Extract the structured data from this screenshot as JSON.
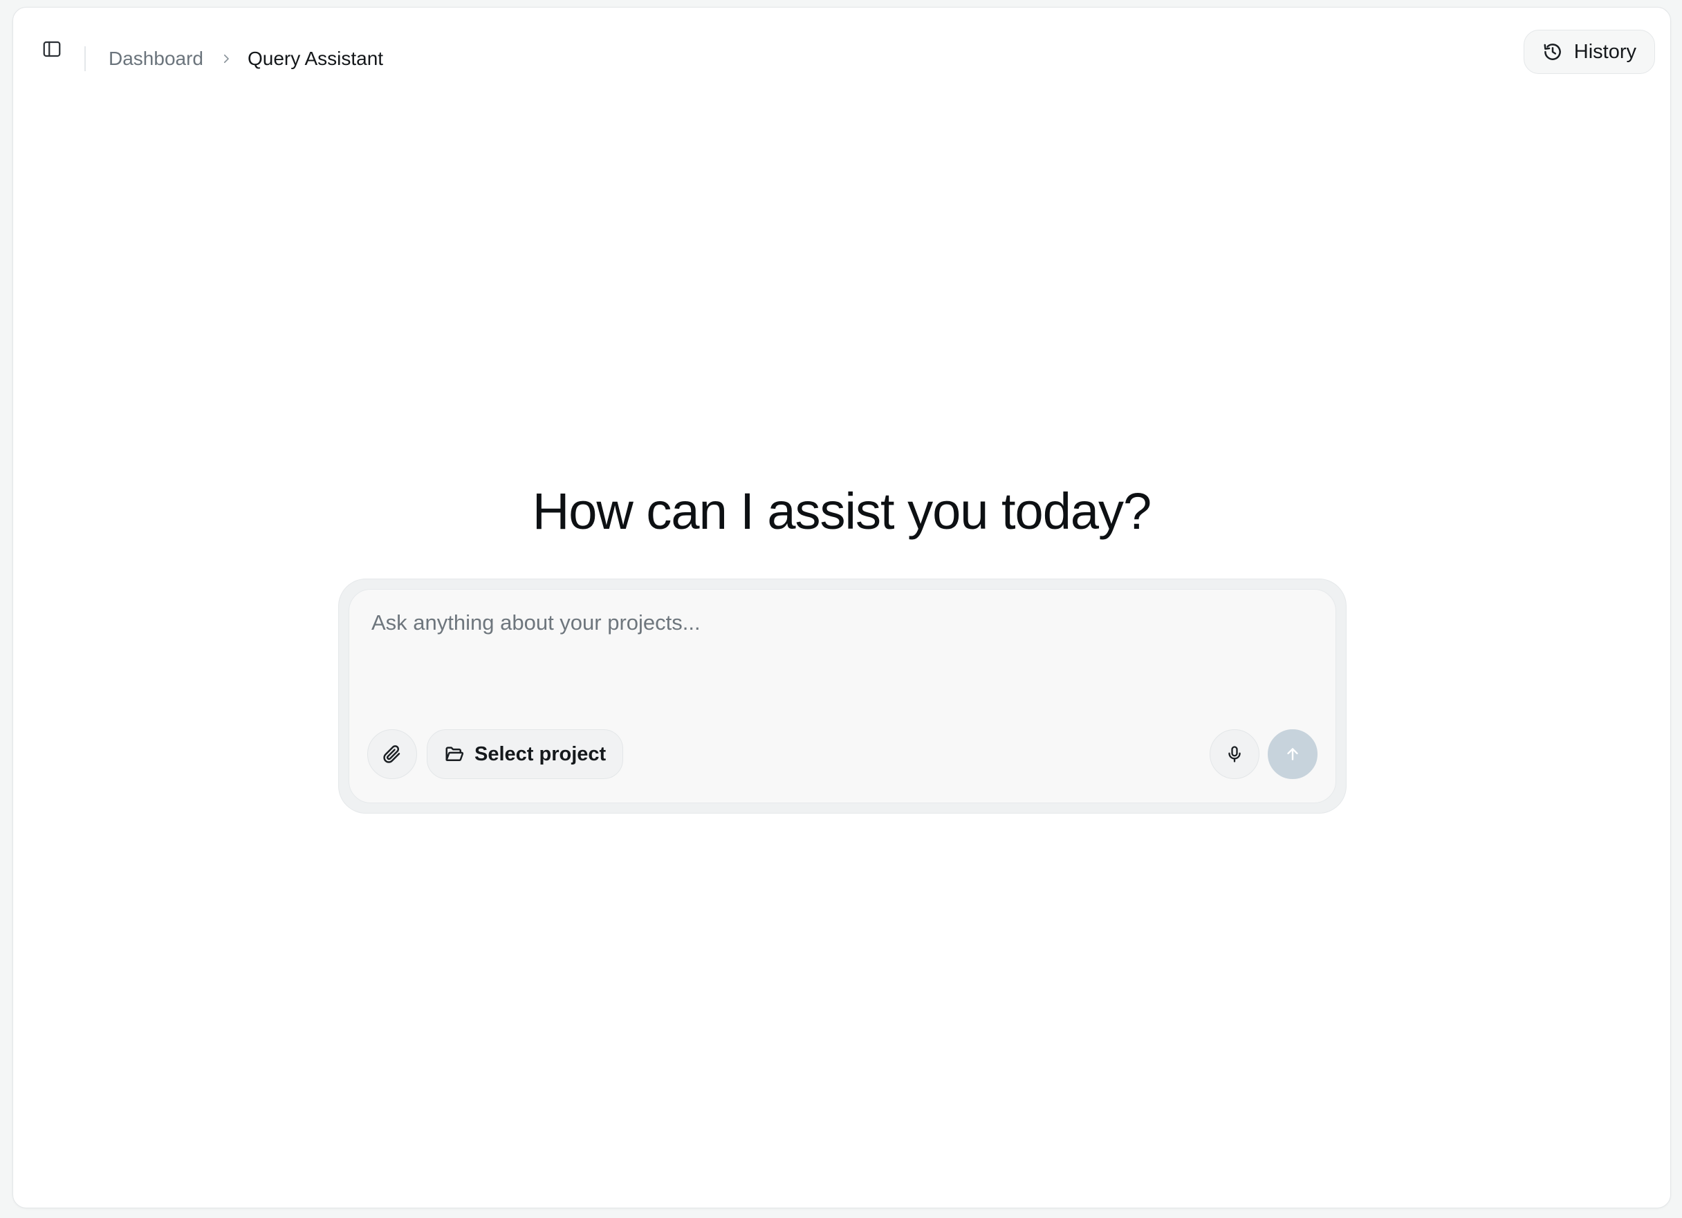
{
  "header": {
    "sidebar_toggle_icon": "sidebar-panel-icon",
    "breadcrumb": {
      "items": [
        "Dashboard",
        "Query Assistant"
      ],
      "separator_icon": "chevron-right-icon"
    },
    "history": {
      "label": "History",
      "icon": "history-clock-icon"
    }
  },
  "main": {
    "title": "How can I assist you today?",
    "composer": {
      "placeholder": "Ask anything about your projects...",
      "value": "",
      "attach_icon": "paperclip-icon",
      "select_project": {
        "label": "Select project",
        "icon": "folder-open-icon"
      },
      "mic_icon": "microphone-icon",
      "send_icon": "arrow-up-icon"
    }
  },
  "colors": {
    "background": "#ffffff",
    "muted_text": "#6b747c",
    "send_disabled": "#c7d3dc"
  }
}
